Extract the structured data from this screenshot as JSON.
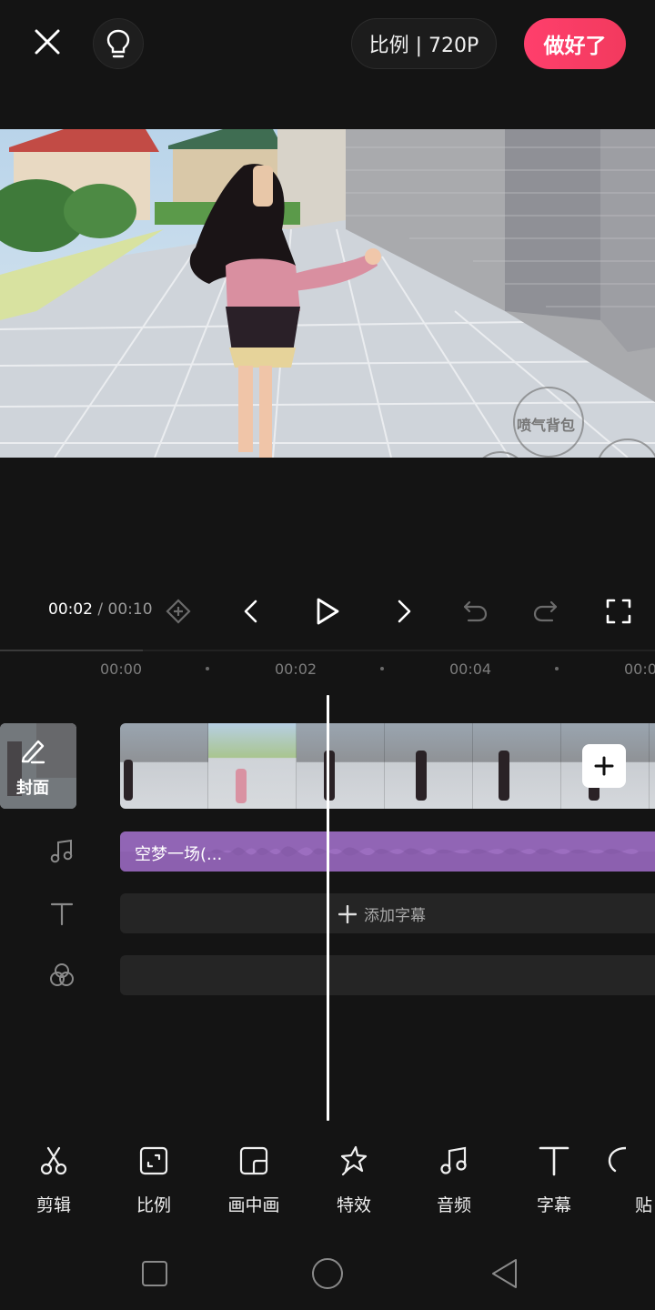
{
  "header": {
    "ratio_label": "比例 | 720P",
    "done_label": "做好了"
  },
  "preview": {
    "watermark": "喷气背包"
  },
  "player": {
    "current_time": "00:02",
    "separator": " / ",
    "total_time": "00:10"
  },
  "timeline": {
    "ruler_labels": [
      "00:00",
      "00:02",
      "00:04",
      "00:0"
    ],
    "cover_label": "封面",
    "audio_label": "空梦一场(...",
    "subtitle_add_label": "添加字幕"
  },
  "toolbar": {
    "items": [
      {
        "label": "剪辑",
        "icon": "scissors-icon"
      },
      {
        "label": "比例",
        "icon": "ratio-icon"
      },
      {
        "label": "画中画",
        "icon": "picture-in-picture-icon"
      },
      {
        "label": "特效",
        "icon": "sparkle-star-icon"
      },
      {
        "label": "音频",
        "icon": "music-note-icon"
      },
      {
        "label": "字幕",
        "icon": "text-icon"
      },
      {
        "label": "贴",
        "icon": "sticker-icon"
      }
    ]
  },
  "colors": {
    "accent": "#ff3f6c",
    "audio_track": "#9c6ec0",
    "background": "#141414"
  }
}
